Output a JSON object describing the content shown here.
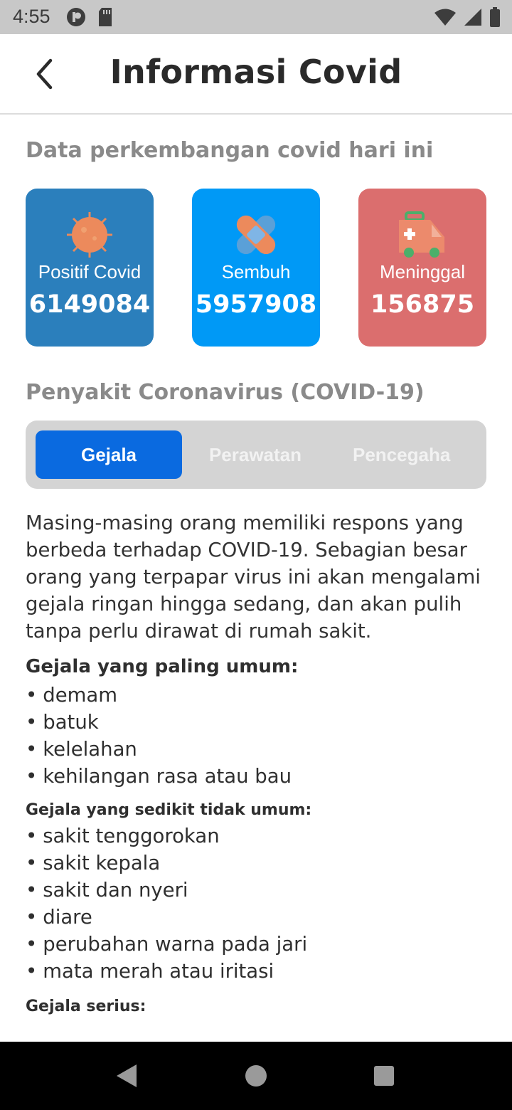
{
  "status_bar": {
    "time": "4:55",
    "left_icons": [
      "sync-icon",
      "sd-card-icon"
    ],
    "right_icons": [
      "wifi-icon",
      "cellular-signal-icon",
      "battery-icon"
    ]
  },
  "app_bar": {
    "title": "Informasi Covid",
    "back_icon": "chevron-left-icon"
  },
  "stats": {
    "section_title": "Data perkembangan covid hari ini",
    "cards": [
      {
        "label": "Positif Covid",
        "value": "6149084",
        "icon": "virus-icon",
        "color": "#2b7fbc"
      },
      {
        "label": "Sembuh",
        "value": "5957908",
        "icon": "bandage-icon",
        "color": "#0099f6"
      },
      {
        "label": "Meninggal",
        "value": "156875",
        "icon": "ambulance-icon",
        "color": "#db6e6e"
      }
    ]
  },
  "disease": {
    "section_title": "Penyakit Coronavirus (COVID-19)",
    "tabs": [
      {
        "label": "Gejala",
        "active": true
      },
      {
        "label": "Perawatan",
        "active": false
      },
      {
        "label": "Pencegaha",
        "active": false
      }
    ],
    "intro": "Masing-masing orang memiliki respons yang berbeda terhadap COVID-19. Sebagian besar orang yang terpapar virus ini akan mengalami gejala ringan hingga sedang, dan akan pulih tanpa perlu dirawat di rumah sakit.",
    "common_title": "Gejala yang paling umum:",
    "common_items": [
      "demam",
      "batuk",
      "kelelahan",
      "kehilangan rasa atau bau"
    ],
    "uncommon_title": "Gejala yang sedikit tidak umum:",
    "uncommon_items": [
      "sakit tenggorokan",
      "sakit kepala",
      "sakit dan nyeri",
      "diare",
      "perubahan warna pada jari",
      "mata merah atau iritasi"
    ],
    "serious_title": "Gejala serius:"
  },
  "nav_bar": {
    "buttons": [
      "back-triangle-icon",
      "home-circle-icon",
      "recents-square-icon"
    ]
  },
  "colors": {
    "accent": "#0a6ae0",
    "tab_bg": "#d4d4d4",
    "positive": "#2b7fbc",
    "recovered": "#0099f6",
    "deceased": "#db6e6e"
  }
}
